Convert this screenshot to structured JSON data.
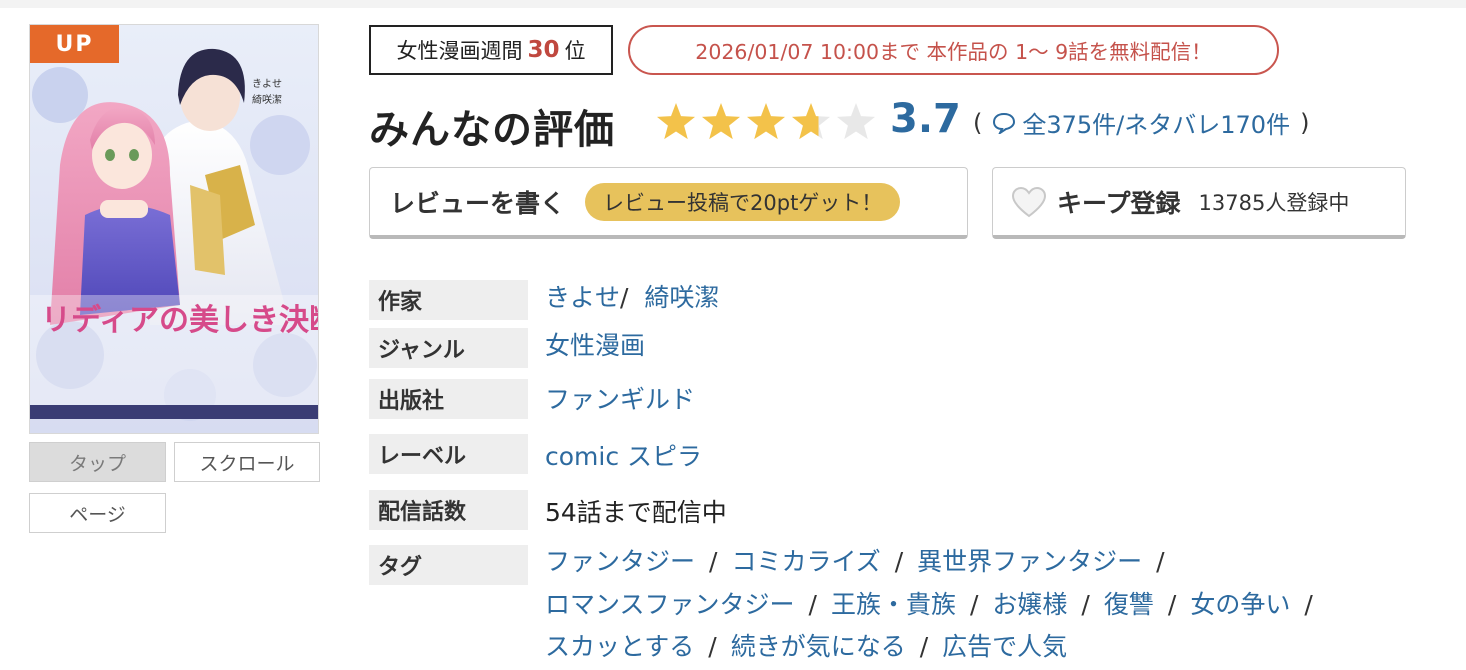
{
  "cover": {
    "badge": "UP",
    "title_lettering": "リディアの美しき決断",
    "credit_lettering": [
      "きよせ",
      "綺咲潔"
    ],
    "view_buttons": [
      {
        "label": "タップ",
        "active": true
      },
      {
        "label": "スクロール",
        "active": false
      },
      {
        "label": "ページ",
        "active": false
      }
    ]
  },
  "ranking": {
    "prefix": "女性漫画週間",
    "number": "30",
    "suffix": "位"
  },
  "free_notice": "2026/01/07 10:00まで 本作品の 1〜 9話を無料配信！",
  "rating": {
    "title": "みんなの評価",
    "value": 3.7,
    "score_text": "3.7",
    "open_paren": "(",
    "count_text": "全375件/ネタバレ170件",
    "close_paren": ")"
  },
  "review_button": {
    "label": "レビューを書く",
    "promo": "レビュー投稿で20ptゲット！"
  },
  "keep_button": {
    "label": "キープ登録",
    "count": "13785人登録中"
  },
  "info": {
    "author_label": "作家",
    "authors": [
      "きよせ",
      "綺咲潔"
    ],
    "author_sep": "/",
    "genre_label": "ジャンル",
    "genre": "女性漫画",
    "publisher_label": "出版社",
    "publisher": "ファンギルド",
    "label_label": "レーベル",
    "label": "comic スピラ",
    "episodes_label": "配信話数",
    "episodes": "54話まで配信中",
    "tags_label": "タグ",
    "tag_sep": "/",
    "tags": [
      "ファンタジー",
      "コミカライズ",
      "異世界ファンタジー",
      "ロマンスファンタジー",
      "王族・貴族",
      "お嬢様",
      "復讐",
      "女の争い",
      "スカッとする",
      "続きが気になる",
      "広告で人気"
    ]
  },
  "colors": {
    "accent_blue": "#2d6a9f",
    "rank_red": "#c0483f",
    "badge_orange": "#e5692a",
    "star_gold": "#f3c24a",
    "promo_yellow": "#e7c25c"
  }
}
